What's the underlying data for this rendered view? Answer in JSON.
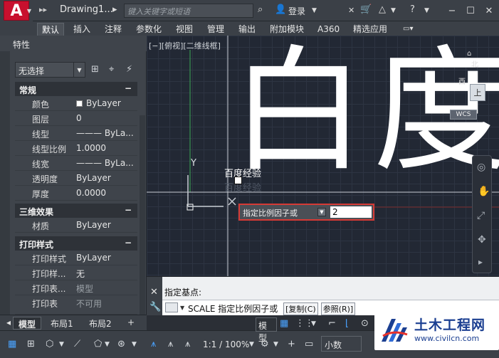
{
  "titlebar": {
    "doc_title": "Drawing1...",
    "search_placeholder": "键入关键字或短语",
    "login": "登录"
  },
  "ribbon": {
    "tabs": [
      "默认",
      "插入",
      "注释",
      "参数化",
      "视图",
      "管理",
      "输出",
      "附加模块",
      "A360",
      "精选应用"
    ]
  },
  "properties": {
    "title": "特性",
    "selection": "无选择",
    "sections": {
      "general": "常规",
      "three_d": "三维效果",
      "plot": "打印样式"
    },
    "general_rows": [
      {
        "key": "颜色",
        "value": "ByLayer"
      },
      {
        "key": "图层",
        "value": "0"
      },
      {
        "key": "线型",
        "value": "——— ByLa..."
      },
      {
        "key": "线型比例",
        "value": "1.0000"
      },
      {
        "key": "线宽",
        "value": "——— ByLa..."
      },
      {
        "key": "透明度",
        "value": "ByLayer"
      },
      {
        "key": "厚度",
        "value": "0.0000"
      }
    ],
    "three_d_rows": [
      {
        "key": "材质",
        "value": "ByLayer"
      }
    ],
    "plot_rows": [
      {
        "key": "打印样式",
        "value": "ByLayer"
      },
      {
        "key": "打印样...",
        "value": "无"
      },
      {
        "key": "打印表...",
        "value": "模型"
      },
      {
        "key": "打印表",
        "value": "不可用"
      }
    ]
  },
  "layout_tabs": [
    "模型",
    "布局1",
    "布局2"
  ],
  "viewport": {
    "label": "[−][俯视][二维线框]",
    "big_text_1": "白",
    "big_text_2": "度",
    "text_copy_1": "百度经验",
    "text_copy_2": "百度经验",
    "prompt_label": "指定比例因子或",
    "prompt_value": "2",
    "ucs_y": "Y",
    "ucs_x": "X",
    "cube_north": "北",
    "cube_west": "西",
    "cube_face": "上",
    "wcs": "WCS"
  },
  "command": {
    "history": "指定基点:",
    "current": "SCALE 指定比例因子或",
    "opt_copy": "[复制(C)",
    "opt_ref": "参照(R)]"
  },
  "status": {
    "model": "模型",
    "scale": "1:1 / 100%",
    "units": "小数"
  },
  "watermark": {
    "title": "土木工程网",
    "url": "www.civilcn.com"
  },
  "colors": {
    "accent_red": "#d63a35",
    "viewport_bg": "#222834",
    "logo_red": "#c8102e",
    "wm_blue": "#1b3f91"
  }
}
